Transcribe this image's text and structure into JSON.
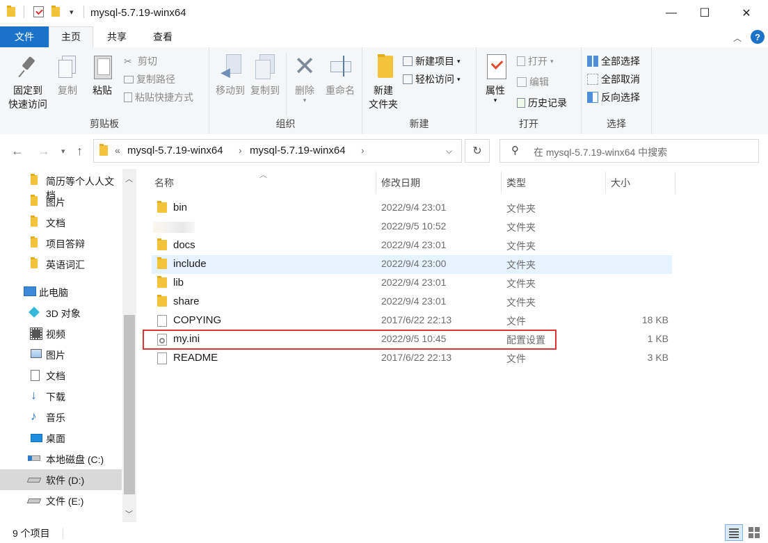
{
  "window": {
    "title": "mysql-5.7.19-winx64",
    "minimize": "—",
    "maximize": "☐",
    "close": "✕"
  },
  "tabs": [
    "文件",
    "主页",
    "共享",
    "查看"
  ],
  "ribbon": {
    "clipboard": {
      "label": "剪贴板",
      "pin": [
        "固定到",
        "快速访问"
      ],
      "copy": "复制",
      "paste": "粘贴",
      "cut": "剪切",
      "copy_path": "复制路径",
      "paste_shortcut": "粘贴快捷方式"
    },
    "organize": {
      "label": "组织",
      "move_to": "移动到",
      "copy_to": "复制到",
      "delete": "删除",
      "rename": "重命名"
    },
    "new": {
      "label": "新建",
      "new_folder": [
        "新建",
        "文件夹"
      ],
      "new_item": "新建项目",
      "easy_access": "轻松访问"
    },
    "open": {
      "label": "打开",
      "properties": "属性",
      "open": "打开",
      "edit": "编辑",
      "history": "历史记录"
    },
    "select": {
      "label": "选择",
      "select_all": "全部选择",
      "select_none": "全部取消",
      "invert": "反向选择"
    }
  },
  "address": {
    "chevron": "«",
    "crumbs": [
      "mysql-5.7.19-winx64",
      "mysql-5.7.19-winx64"
    ],
    "search_placeholder": "在 mysql-5.7.19-winx64 中搜索"
  },
  "nav_pane": {
    "quick": [
      "简历等个人人文档",
      "图片",
      "文档",
      "项目答辩",
      "英语词汇"
    ],
    "this_pc": "此电脑",
    "pc_items": [
      "3D 对象",
      "视频",
      "图片",
      "文档",
      "下载",
      "音乐",
      "桌面",
      "本地磁盘 (C:)",
      "软件 (D:)",
      "文件 (E:)"
    ]
  },
  "columns": {
    "name": "名称",
    "date": "修改日期",
    "type": "类型",
    "size": "大小"
  },
  "files": [
    {
      "name": "bin",
      "date": "2022/9/4 23:01",
      "type": "文件夹",
      "size": "",
      "icon": "folder"
    },
    {
      "name": "",
      "date": "2022/9/5 10:52",
      "type": "文件夹",
      "size": "",
      "icon": "blurred"
    },
    {
      "name": "docs",
      "date": "2022/9/4 23:01",
      "type": "文件夹",
      "size": "",
      "icon": "folder"
    },
    {
      "name": "include",
      "date": "2022/9/4 23:00",
      "type": "文件夹",
      "size": "",
      "icon": "folder"
    },
    {
      "name": "lib",
      "date": "2022/9/4 23:01",
      "type": "文件夹",
      "size": "",
      "icon": "folder"
    },
    {
      "name": "share",
      "date": "2022/9/4 23:01",
      "type": "文件夹",
      "size": "",
      "icon": "folder"
    },
    {
      "name": "COPYING",
      "date": "2017/6/22 22:13",
      "type": "文件",
      "size": "18 KB",
      "icon": "file"
    },
    {
      "name": "my.ini",
      "date": "2022/9/5 10:45",
      "type": "配置设置",
      "size": "1 KB",
      "icon": "ini"
    },
    {
      "name": "README",
      "date": "2017/6/22 22:13",
      "type": "文件",
      "size": "3 KB",
      "icon": "file"
    }
  ],
  "status": {
    "count": "9 个项目"
  },
  "colors": {
    "accent": "#1a73c8",
    "hover_row": "#e5f3ff",
    "highlight_box": "#e03333",
    "folder": "#f3c33c"
  }
}
